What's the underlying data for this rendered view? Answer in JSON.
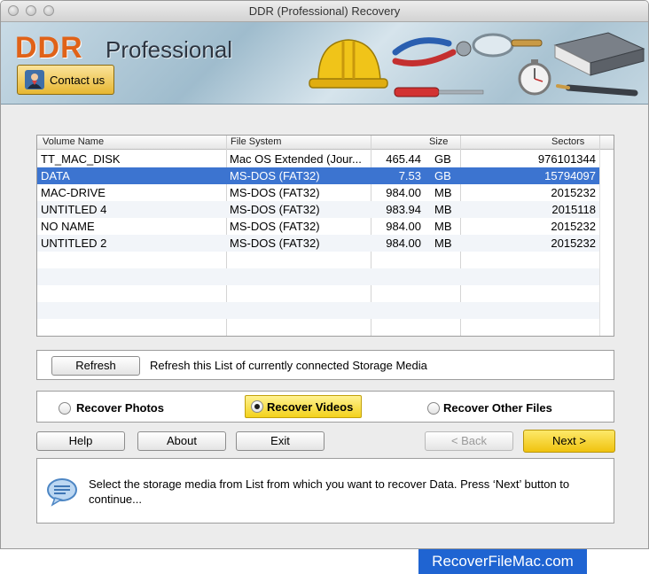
{
  "window": {
    "title": "DDR (Professional) Recovery"
  },
  "banner": {
    "logo": "DDR",
    "logo_sub": "Professional",
    "contact_label": "Contact us"
  },
  "table": {
    "columns": [
      "Volume Name",
      "File System",
      "Size",
      "Sectors"
    ],
    "rows": [
      {
        "name": "TT_MAC_DISK",
        "fs": "Mac OS Extended (Jour...",
        "size": "465.44",
        "unit": "GB",
        "sectors": "976101344"
      },
      {
        "name": "DATA",
        "fs": "MS-DOS (FAT32)",
        "size": "7.53",
        "unit": "GB",
        "sectors": "15794097"
      },
      {
        "name": "MAC-DRIVE",
        "fs": "MS-DOS (FAT32)",
        "size": "984.00",
        "unit": "MB",
        "sectors": "2015232"
      },
      {
        "name": "UNTITLED 4",
        "fs": "MS-DOS (FAT32)",
        "size": "983.94",
        "unit": "MB",
        "sectors": "2015118"
      },
      {
        "name": "NO NAME",
        "fs": "MS-DOS (FAT32)",
        "size": "984.00",
        "unit": "MB",
        "sectors": "2015232"
      },
      {
        "name": "UNTITLED 2",
        "fs": "MS-DOS (FAT32)",
        "size": "984.00",
        "unit": "MB",
        "sectors": "2015232"
      }
    ],
    "selected_row": 1
  },
  "refresh": {
    "button_label": "Refresh",
    "description": "Refresh this List of currently connected Storage Media"
  },
  "options": {
    "photos": "Recover Photos",
    "videos": "Recover Videos",
    "other": "Recover Other Files",
    "selected": "videos"
  },
  "buttons": {
    "help": "Help",
    "about": "About",
    "exit": "Exit",
    "back": "< Back",
    "next": "Next >"
  },
  "message": "Select the storage media from List from which you want to recover Data. Press ‘Next’ button to continue...",
  "footer": {
    "site": "RecoverFileMac.com"
  },
  "colors": {
    "selection": "#3c74d0",
    "accent_yellow": "#f0c30f",
    "logo_orange": "#e06218",
    "badge_blue": "#1f64d2"
  }
}
